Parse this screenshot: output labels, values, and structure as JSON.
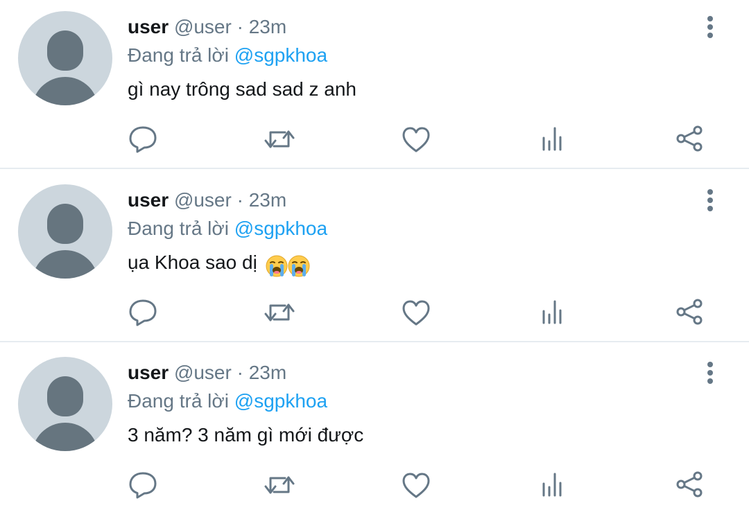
{
  "colors": {
    "name": "#14171a",
    "secondary": "#657786",
    "mention": "#1da1f2",
    "icon": "#657786",
    "avatar_bg": "#ccd6dd",
    "avatar_fg": "#66757f",
    "separator": "#e6ecf0"
  },
  "tweets": [
    {
      "display_name": "user",
      "handle": "@user",
      "dot": "·",
      "time": "23m",
      "reply_prefix": "Đang trả lời",
      "reply_mention": "@sgpkhoa",
      "text": "gì nay trông sad sad z anh",
      "emojis": []
    },
    {
      "display_name": "user",
      "handle": "@user",
      "dot": "·",
      "time": "23m",
      "reply_prefix": "Đang trả lời",
      "reply_mention": "@sgpkhoa",
      "text": "ụa Khoa sao dị",
      "emojis": [
        "loudly-crying-face",
        "loudly-crying-face"
      ]
    },
    {
      "display_name": "user",
      "handle": "@user",
      "dot": "·",
      "time": "23m",
      "reply_prefix": "Đang trả lời",
      "reply_mention": "@sgpkhoa",
      "text": "3 năm? 3 năm gì mới được",
      "emojis": []
    }
  ],
  "action_icons": [
    "reply-icon",
    "retweet-icon",
    "like-icon",
    "stats-icon",
    "share-icon"
  ],
  "menu_icon": "more-vertical-icon"
}
